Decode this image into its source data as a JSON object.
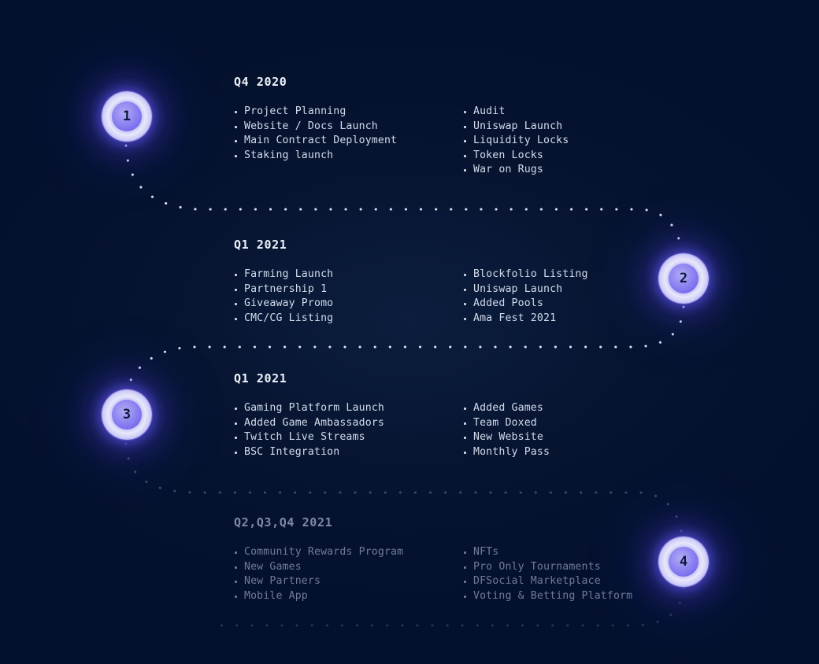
{
  "theme": {
    "background": "#04112e",
    "node_accent": "#6f63ec",
    "node_highlight": "#e8e8fb",
    "text_primary": "#d3dbeb",
    "text_heading": "#eef2fa",
    "text_dim": "#6f7b99",
    "connector_dot": "#d9e2f5"
  },
  "milestones": [
    {
      "marker": "1",
      "heading": "Q4 2020",
      "dim": false,
      "left_column": [
        "Project Planning",
        "Website / Docs Launch",
        "Main Contract Deployment",
        "Staking launch"
      ],
      "right_column": [
        "Audit",
        "Uniswap Launch",
        "Liquidity Locks",
        "Token Locks",
        "War on Rugs"
      ]
    },
    {
      "marker": "2",
      "heading": "Q1 2021",
      "dim": false,
      "left_column": [
        "Farming Launch",
        "Partnership 1",
        "Giveaway Promo",
        "CMC/CG Listing"
      ],
      "right_column": [
        "Blockfolio Listing",
        "Uniswap Launch",
        "Added Pools",
        "Ama Fest 2021"
      ]
    },
    {
      "marker": "3",
      "heading": "Q1 2021",
      "dim": false,
      "left_column": [
        "Gaming Platform Launch",
        "Added Game Ambassadors",
        "Twitch Live Streams",
        "BSC Integration"
      ],
      "right_column": [
        "Added Games",
        "Team Doxed",
        "New Website",
        "Monthly Pass"
      ]
    },
    {
      "marker": "4",
      "heading": "Q2,Q3,Q4 2021",
      "dim": true,
      "left_column": [
        "Community Rewards Program",
        "New Games",
        "New Partners",
        "Mobile App"
      ],
      "right_column": [
        "NFTs",
        "Pro Only Tournaments",
        "DFSocial Marketplace",
        "Voting & Betting Platform"
      ]
    }
  ]
}
